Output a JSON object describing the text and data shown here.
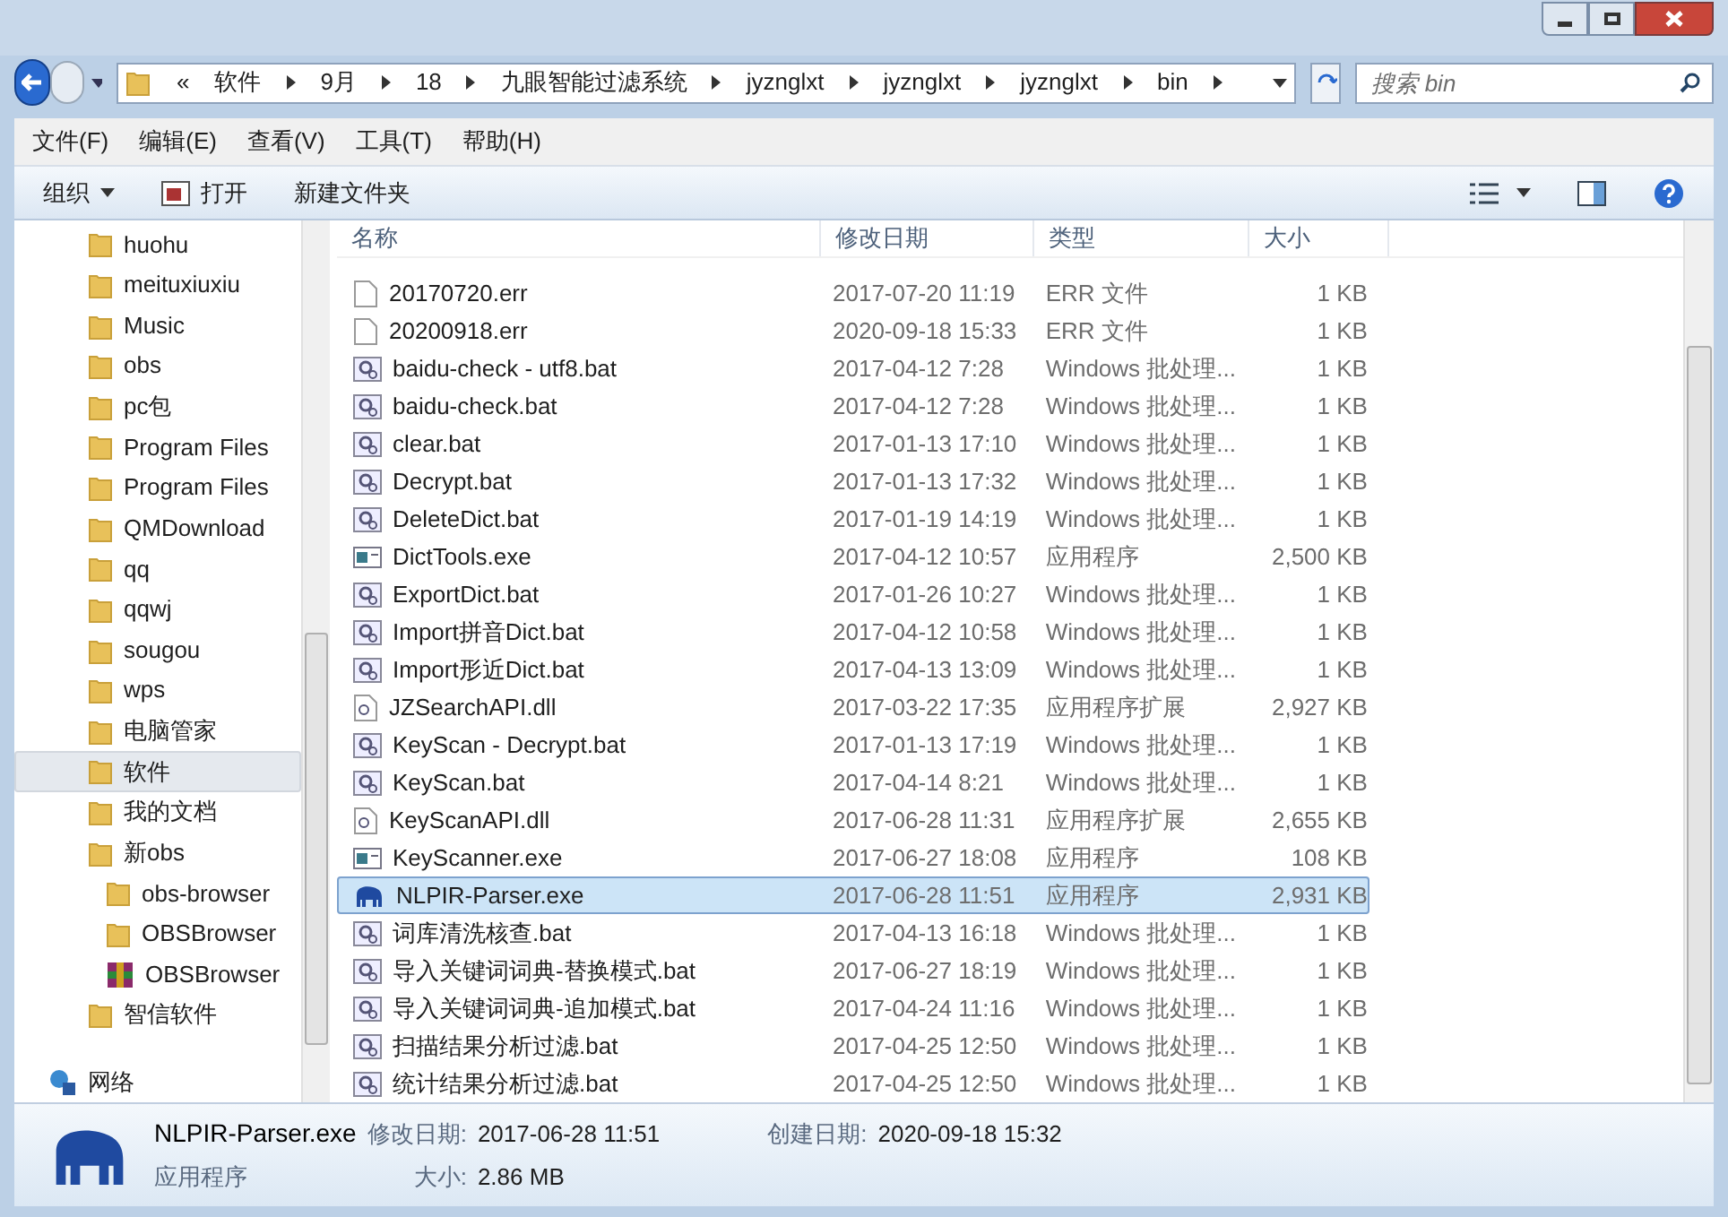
{
  "address": {
    "crumbs": [
      "«",
      "软件",
      "9月",
      "18",
      "九眼智能过滤系统",
      "jyznglxt",
      "jyznglxt",
      "jyznglxt",
      "bin"
    ]
  },
  "search": {
    "placeholder": "搜索 bin"
  },
  "menu": [
    "文件(F)",
    "编辑(E)",
    "查看(V)",
    "工具(T)",
    "帮助(H)"
  ],
  "toolbar": [
    {
      "label": "组织",
      "kind": "dropdown"
    },
    {
      "label": "打开",
      "kind": "open"
    },
    {
      "label": "新建文件夹",
      "kind": "plain"
    }
  ],
  "sidebar": {
    "items": [
      {
        "label": "huohu",
        "kind": "folder",
        "selected": false
      },
      {
        "label": "meituxiuxiu",
        "kind": "folder",
        "selected": false
      },
      {
        "label": "Music",
        "kind": "folder",
        "selected": false
      },
      {
        "label": "obs",
        "kind": "folder",
        "selected": false
      },
      {
        "label": "pc包",
        "kind": "folder",
        "selected": false
      },
      {
        "label": "Program Files",
        "kind": "folder",
        "selected": false
      },
      {
        "label": "Program Files",
        "kind": "folder",
        "selected": false
      },
      {
        "label": "QMDownload",
        "kind": "folder",
        "selected": false
      },
      {
        "label": "qq",
        "kind": "folder",
        "selected": false
      },
      {
        "label": "qqwj",
        "kind": "folder",
        "selected": false
      },
      {
        "label": "sougou",
        "kind": "folder",
        "selected": false
      },
      {
        "label": "wps",
        "kind": "folder",
        "selected": false
      },
      {
        "label": "电脑管家",
        "kind": "folder",
        "selected": false
      },
      {
        "label": "软件",
        "kind": "folder",
        "selected": true
      },
      {
        "label": "我的文档",
        "kind": "folder",
        "selected": false
      },
      {
        "label": "新obs",
        "kind": "folder",
        "selected": false,
        "children": [
          {
            "label": "obs-browser",
            "kind": "folder",
            "selected": false
          },
          {
            "label": "OBSBrowser",
            "kind": "folder",
            "selected": false
          },
          {
            "label": "OBSBrowser",
            "kind": "archive",
            "selected": false
          }
        ]
      },
      {
        "label": "智信软件",
        "kind": "folder",
        "selected": false
      },
      {
        "label": "网络",
        "kind": "network",
        "selected": false
      }
    ]
  },
  "table": {
    "columns": [
      "名称",
      "修改日期",
      "类型",
      "大小"
    ],
    "rows": [
      {
        "name": "20170720.err",
        "date": "2017-07-20 11:19",
        "type": "ERR 文件",
        "size": "1 KB",
        "kind": "file",
        "selected": false
      },
      {
        "name": "20200918.err",
        "date": "2020-09-18 15:33",
        "type": "ERR 文件",
        "size": "1 KB",
        "kind": "file",
        "selected": false
      },
      {
        "name": "baidu-check - utf8.bat",
        "date": "2017-04-12 7:28",
        "type": "Windows 批处理...",
        "size": "1 KB",
        "kind": "bat",
        "selected": false
      },
      {
        "name": "baidu-check.bat",
        "date": "2017-04-12 7:28",
        "type": "Windows 批处理...",
        "size": "1 KB",
        "kind": "bat",
        "selected": false
      },
      {
        "name": "clear.bat",
        "date": "2017-01-13 17:10",
        "type": "Windows 批处理...",
        "size": "1 KB",
        "kind": "bat",
        "selected": false
      },
      {
        "name": "Decrypt.bat",
        "date": "2017-01-13 17:32",
        "type": "Windows 批处理...",
        "size": "1 KB",
        "kind": "bat",
        "selected": false
      },
      {
        "name": "DeleteDict.bat",
        "date": "2017-01-19 14:19",
        "type": "Windows 批处理...",
        "size": "1 KB",
        "kind": "bat",
        "selected": false
      },
      {
        "name": "DictTools.exe",
        "date": "2017-04-12 10:57",
        "type": "应用程序",
        "size": "2,500 KB",
        "kind": "exe",
        "selected": false
      },
      {
        "name": "ExportDict.bat",
        "date": "2017-01-26 10:27",
        "type": "Windows 批处理...",
        "size": "1 KB",
        "kind": "bat",
        "selected": false
      },
      {
        "name": "Import拼音Dict.bat",
        "date": "2017-04-12 10:58",
        "type": "Windows 批处理...",
        "size": "1 KB",
        "kind": "bat",
        "selected": false
      },
      {
        "name": "Import形近Dict.bat",
        "date": "2017-04-13 13:09",
        "type": "Windows 批处理...",
        "size": "1 KB",
        "kind": "bat",
        "selected": false
      },
      {
        "name": "JZSearchAPI.dll",
        "date": "2017-03-22 17:35",
        "type": "应用程序扩展",
        "size": "2,927 KB",
        "kind": "dll",
        "selected": false
      },
      {
        "name": "KeyScan - Decrypt.bat",
        "date": "2017-01-13 17:19",
        "type": "Windows 批处理...",
        "size": "1 KB",
        "kind": "bat",
        "selected": false
      },
      {
        "name": "KeyScan.bat",
        "date": "2017-04-14 8:21",
        "type": "Windows 批处理...",
        "size": "1 KB",
        "kind": "bat",
        "selected": false
      },
      {
        "name": "KeyScanAPI.dll",
        "date": "2017-06-28 11:31",
        "type": "应用程序扩展",
        "size": "2,655 KB",
        "kind": "dll",
        "selected": false
      },
      {
        "name": "KeyScanner.exe",
        "date": "2017-06-27 18:08",
        "type": "应用程序",
        "size": "108 KB",
        "kind": "exe",
        "selected": false
      },
      {
        "name": "NLPIR-Parser.exe",
        "date": "2017-06-28 11:51",
        "type": "应用程序",
        "size": "2,931 KB",
        "kind": "elephant",
        "selected": true
      },
      {
        "name": "词库清洗核查.bat",
        "date": "2017-04-13 16:18",
        "type": "Windows 批处理...",
        "size": "1 KB",
        "kind": "bat",
        "selected": false
      },
      {
        "name": "导入关键词词典-替换模式.bat",
        "date": "2017-06-27 18:19",
        "type": "Windows 批处理...",
        "size": "1 KB",
        "kind": "bat",
        "selected": false
      },
      {
        "name": "导入关键词词典-追加模式.bat",
        "date": "2017-04-24 11:16",
        "type": "Windows 批处理...",
        "size": "1 KB",
        "kind": "bat",
        "selected": false
      },
      {
        "name": "扫描结果分析过滤.bat",
        "date": "2017-04-25 12:50",
        "type": "Windows 批处理...",
        "size": "1 KB",
        "kind": "bat",
        "selected": false
      },
      {
        "name": "统计结果分析过滤.bat",
        "date": "2017-04-25 12:50",
        "type": "Windows 批处理...",
        "size": "1 KB",
        "kind": "bat",
        "selected": false
      }
    ]
  },
  "details": {
    "name": "NLPIR-Parser.exe",
    "type": "应用程序",
    "fields": [
      {
        "label": "修改日期:",
        "value": "2017-06-28 11:51"
      },
      {
        "label": "创建日期:",
        "value": "2020-09-18 15:32"
      },
      {
        "label": "大小:",
        "value": "2.86 MB"
      }
    ]
  }
}
